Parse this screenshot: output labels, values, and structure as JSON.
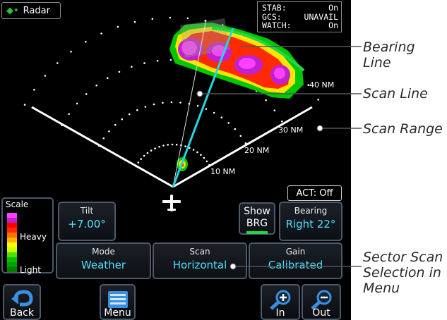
{
  "title": "Radar",
  "status": [
    {
      "label": "STAB:",
      "value": "On"
    },
    {
      "label": "GCS:",
      "value": "UNAVAIL"
    },
    {
      "label": "WATCH:",
      "value": "On"
    }
  ],
  "ranges": [
    "10 NM",
    "20 NM",
    "30 NM",
    "40 NM"
  ],
  "act": "ACT: Off",
  "scale": {
    "title": "Scale",
    "heavy": "Heavy",
    "light": "Light",
    "colors": [
      "#ff40ff",
      "#c020d0",
      "#ff0000",
      "#ff2a00",
      "#ff7000",
      "#ffb000",
      "#ffff00",
      "#c8ff00",
      "#50e000",
      "#00c000",
      "#00a000",
      "#008000"
    ]
  },
  "tilt": {
    "label": "Tilt",
    "value": "+7.00°"
  },
  "show_brg": {
    "line1": "Show",
    "line2": "BRG"
  },
  "bearing": {
    "label": "Bearing",
    "value": "Right 22°"
  },
  "mode": {
    "label": "Mode",
    "value": "Weather"
  },
  "scan": {
    "label": "Scan",
    "value": "Horizontal"
  },
  "gain": {
    "label": "Gain",
    "value": "Calibrated"
  },
  "nav": {
    "back": "Back",
    "menu": "Menu",
    "in": "In",
    "out": "Out"
  },
  "callouts": {
    "bearing_line": "Bearing Line",
    "scan_line": "Scan Line",
    "scan_range": "Scan Range",
    "sector_line1": "Sector Scan",
    "sector_line2": "Selection in",
    "sector_line3": "Menu"
  },
  "colors": {
    "accent_cyan": "#4fe0ff",
    "bearing_line": "#20d8e0",
    "button_border": "#4a5a6a"
  }
}
